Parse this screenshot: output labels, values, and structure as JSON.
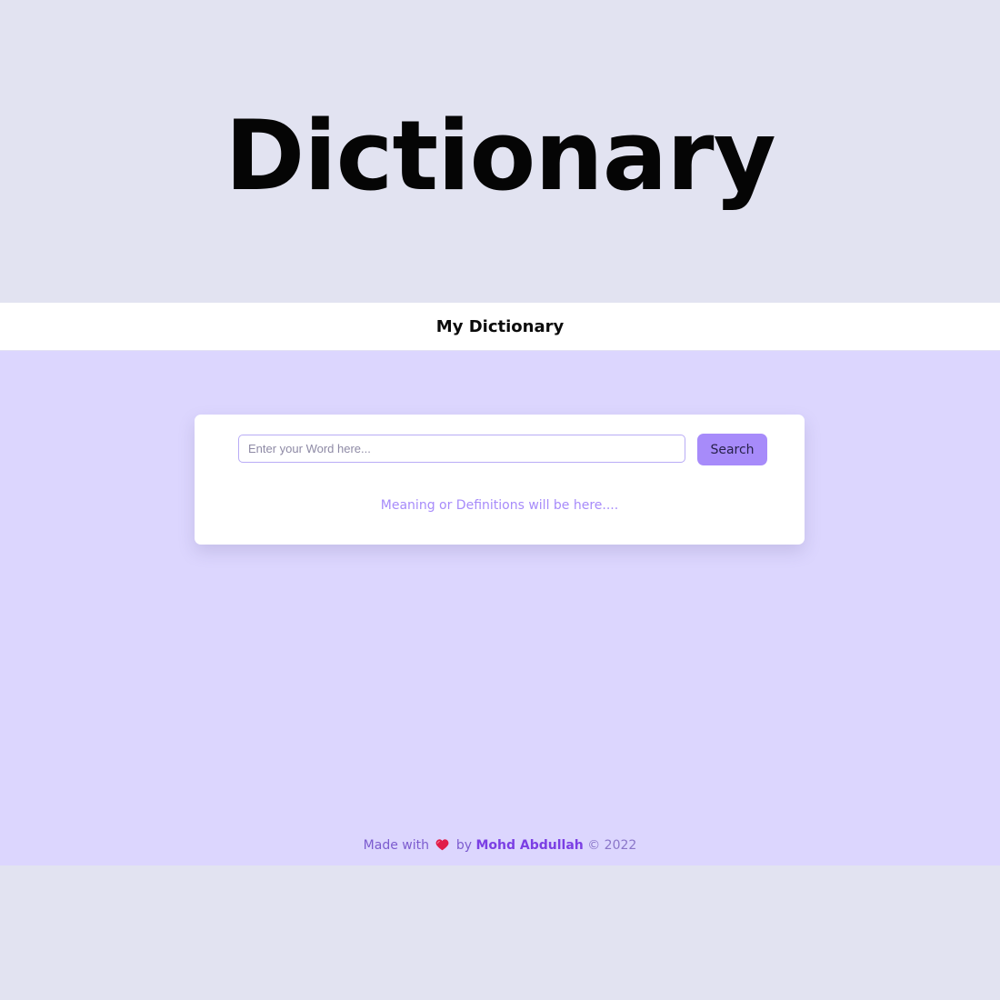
{
  "hero": {
    "title": "Dictionary"
  },
  "navbar": {
    "brand": "My Dictionary"
  },
  "search": {
    "placeholder": "Enter your Word here...",
    "button_label": "Search",
    "result_placeholder": "Meaning or Definitions will be here...."
  },
  "footer": {
    "made_with": "Made with",
    "heart_icon": "heart-icon",
    "by": "by",
    "author": "Mohd Abdullah",
    "copyright": "© 2022"
  },
  "colors": {
    "page_background": "#e2e3f1",
    "main_background": "#dcd6fe",
    "accent": "#a78bfa",
    "author": "#7b3fe4",
    "heart": "#e11d48"
  }
}
